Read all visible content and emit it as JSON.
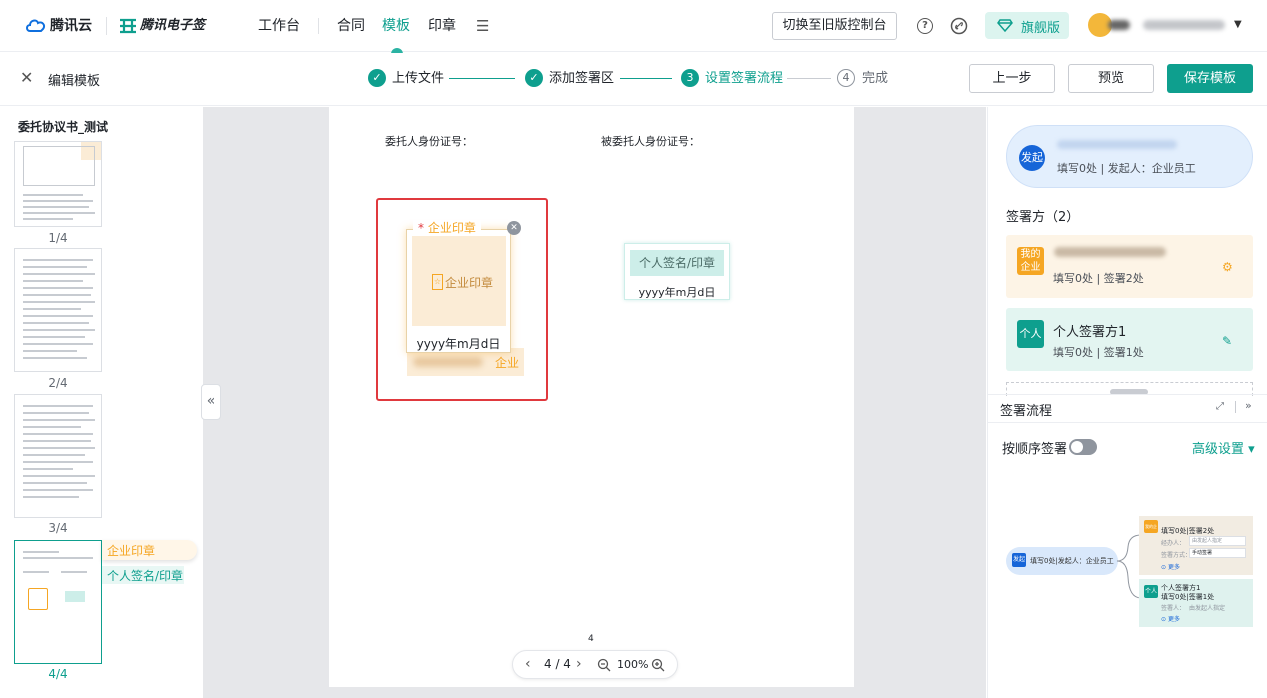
{
  "topnav": {
    "brand_cloud": "腾讯云",
    "brand_product": "腾讯电子签",
    "menu": [
      "工作台",
      "合同",
      "模板",
      "印章"
    ],
    "legacy_button": "切换至旧版控制台",
    "edition_badge": "旗舰版"
  },
  "stepbar": {
    "close_title": "编辑模板",
    "steps": [
      {
        "num": "✓",
        "label": "上传文件"
      },
      {
        "num": "✓",
        "label": "添加签署区"
      },
      {
        "num": "3",
        "label": "设置签署流程"
      },
      {
        "num": "4",
        "label": "完成"
      }
    ],
    "prev_button": "上一步",
    "preview_button": "预览",
    "save_button": "保存模板"
  },
  "leftpanel": {
    "doc_title": "委托协议书_测试",
    "pages": [
      "1/4",
      "2/4",
      "3/4",
      "4/4"
    ],
    "tags": {
      "enterprise_seal": "企业印章",
      "personal_sign": "个人签名/印章"
    }
  },
  "document": {
    "label_left": "委托人身份证号：",
    "label_right": "被委托人身份证号：",
    "seal_label": "企业印章",
    "seal_inner": "企业印章",
    "seal_date": "yyyy年m月d日",
    "behind_text": "企业",
    "personal_label": "个人签名/印章",
    "personal_date": "yyyy年m月d日",
    "page_number": "4"
  },
  "pager": {
    "page_indicator": "4 / 4",
    "zoom": "100%"
  },
  "rightpanel": {
    "initiator": {
      "badge": "发起",
      "info": "填写0处 | 发起人：企业员工"
    },
    "signers_title": "签署方（2）",
    "signer_company": {
      "badge_line1": "我的",
      "badge_line2": "企业",
      "info": "填写0处 | 签署2处"
    },
    "signer_person": {
      "badge": "个人",
      "name": "个人签署方1",
      "info": "填写0处 | 签署1处"
    },
    "flow_title": "签署流程",
    "order_label": "按顺序签署",
    "advanced_label": "高级设置",
    "order_enabled": false,
    "mini": {
      "initiator_badge": "发起",
      "initiator_text": "填写0处|发起人：企业员工",
      "company_badge": "我的企业",
      "company_info": "填写0处|签署2处",
      "company_person_label": "经办人：",
      "company_person_value": "由发起人指定",
      "company_method_label": "签署方式：",
      "company_method_value": "手动签署",
      "company_more": "更多",
      "person_badge": "个人",
      "person_name": "个人签署方1",
      "person_info": "填写0处|签署1处",
      "person_signer_label": "签署人：",
      "person_signer_value": "由发起人指定",
      "person_more": "更多"
    }
  },
  "colors": {
    "accent": "#0e9f8e",
    "highlight_red": "#e0393e",
    "seal_orange": "#f5a623"
  }
}
